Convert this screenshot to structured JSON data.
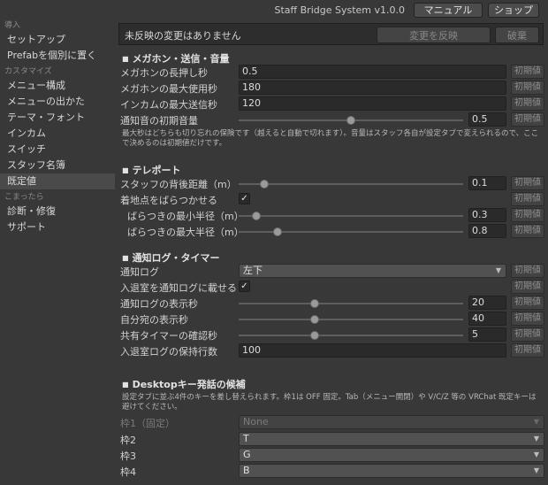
{
  "topbar": {
    "system_name": "Staff Bridge System v1.0.0",
    "manual_label": "マニュアル",
    "shop_label": "ショップ"
  },
  "sidebar": {
    "groups": [
      {
        "heading": "導入",
        "items": [
          "セットアップ",
          "Prefabを個別に置く"
        ]
      },
      {
        "heading": "カスタマイズ",
        "items": [
          "メニュー構成",
          "メニューの出かた",
          "テーマ・フォント",
          "インカム",
          "スイッチ",
          "スタッフ名簿",
          "既定値"
        ]
      },
      {
        "heading": "こまったら",
        "items": [
          "診断・修復",
          "サポート"
        ]
      }
    ],
    "selected": "既定値"
  },
  "status": {
    "message": "未反映の変更はありません",
    "apply_label": "変更を反映",
    "discard_label": "破棄"
  },
  "reset_label": "初期値",
  "sections": {
    "megaphone": {
      "title": "メガホン・送信・音量",
      "long_press_label": "メガホンの長押し秒",
      "long_press_value": "0.5",
      "max_use_label": "メガホンの最大使用秒",
      "max_use_value": "180",
      "incom_max_label": "インカムの最大送信秒",
      "incom_max_value": "120",
      "volume_label": "通知音の初期音量",
      "volume_value": "0.5",
      "note": "最大秒はどちらも切り忘れの保険です（越えると自動で切れます）。音量はスタッフ各自が設定タブで変えられるので、ここで決めるのは初期値だけです。"
    },
    "teleport": {
      "title": "テレポート",
      "back_dist_label": "スタッフの背後距離（m）",
      "back_dist_value": "0.1",
      "scatter_label": "着地点をばらつかせる",
      "scatter_checked": "✓",
      "min_radius_label": "ばらつきの最小半径（m）",
      "min_radius_value": "0.3",
      "max_radius_label": "ばらつきの最大半径（m）",
      "max_radius_value": "0.8"
    },
    "notify": {
      "title": "通知ログ・タイマー",
      "log_label": "通知ログ",
      "log_value": "左下",
      "entry_label": "入退室を通知ログに載せる",
      "entry_checked": "✓",
      "log_sec_label": "通知ログの表示秒",
      "log_sec_value": "20",
      "self_sec_label": "自分宛の表示秒",
      "self_sec_value": "40",
      "timer_label": "共有タイマーの確認秒",
      "timer_value": "5",
      "history_label": "入退室ログの保持行数",
      "history_value": "100"
    },
    "desktop": {
      "title": "Desktopキー発話の候補",
      "note": "設定タブに並ぶ4件のキーを差し替えられます。枠1は OFF 固定。Tab（メニュー開閉）や V/C/Z 等の VRChat 既定キーは避けてください。",
      "slot1_label": "枠1（固定）",
      "slot1_value": "None",
      "slot2_label": "枠2",
      "slot2_value": "T",
      "slot3_label": "枠3",
      "slot3_value": "G",
      "slot4_label": "枠4",
      "slot4_value": "B"
    }
  },
  "sliders": {
    "volume": 0.5,
    "back_dist": 0.1,
    "min_radius": 0.3,
    "max_radius": 0.8,
    "log_sec": 20,
    "self_sec": 40,
    "timer": 5
  },
  "icons": {
    "checkmark": "checkmark-icon",
    "dropdown": "dropdown-arrow-icon"
  }
}
